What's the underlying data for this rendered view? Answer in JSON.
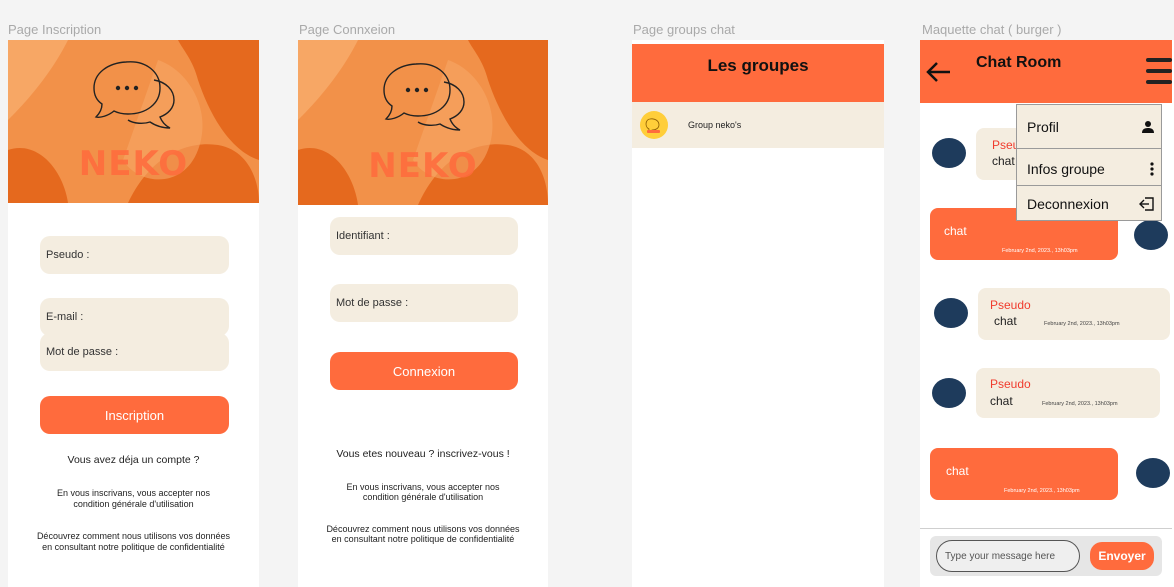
{
  "frames": {
    "inscription_title": "Page Inscription",
    "connexion_title": "Page Connxeion",
    "groups_title": "Page groups  chat",
    "chat_title": "Maquette chat ( burger )"
  },
  "brand": {
    "name": "NEKO",
    "bubble_dots": "..."
  },
  "inscription": {
    "pseudo_label": "Pseudo :",
    "email_label": "E-mail :",
    "password_label": "Mot de passe :",
    "submit_label": "Inscription",
    "have_account": "Vous avez déja un compte ?",
    "terms_line1": "En vous inscrivans, vous accepter nos",
    "terms_line2": "condition générale d'utilisation",
    "privacy_line1": "Découvrez comment nous utilisons vos données",
    "privacy_line2": "en consultant notre politique de confidentialité"
  },
  "connexion": {
    "id_label": "Identifiant :",
    "password_label": "Mot de passe :",
    "submit_label": "Connexion",
    "new_user": "Vous etes nouveau ? inscrivez-vous !",
    "terms_line1": "En vous inscrivans, vous accepter nos",
    "terms_line2": "condition générale d'utilisation",
    "privacy_line1": "Découvrez comment nous utilisons vos données",
    "privacy_line2": "en consultant notre politique de confidentialité"
  },
  "groups": {
    "header": "Les groupes",
    "items": [
      {
        "name": "Group neko's"
      }
    ]
  },
  "chat": {
    "header": "Chat Room",
    "menu": {
      "profile": "Profil",
      "group_info": "Infos groupe",
      "logout": "Deconnexion"
    },
    "messages": [
      {
        "nick": "Pseudo",
        "text": "chat",
        "time": ""
      },
      {
        "nick": "",
        "text": "chat",
        "time": "February 2nd, 2023., 13h03pm"
      },
      {
        "nick": "Pseudo",
        "text": "chat",
        "time": "February 2nd, 2023., 13h03pm"
      },
      {
        "nick": "Pseudo",
        "text": "chat",
        "time": "February 2nd, 2023., 13h03pm"
      },
      {
        "nick": "",
        "text": "chat",
        "time": "February 2nd, 2023., 13h03pm"
      }
    ],
    "input_placeholder": "Type your message here",
    "send_label": "Envoyer"
  },
  "colors": {
    "accent": "#ff6b3d",
    "field_bg": "#f4ede0",
    "avatar": "#1e3b5c",
    "nick": "#f03c2e"
  }
}
